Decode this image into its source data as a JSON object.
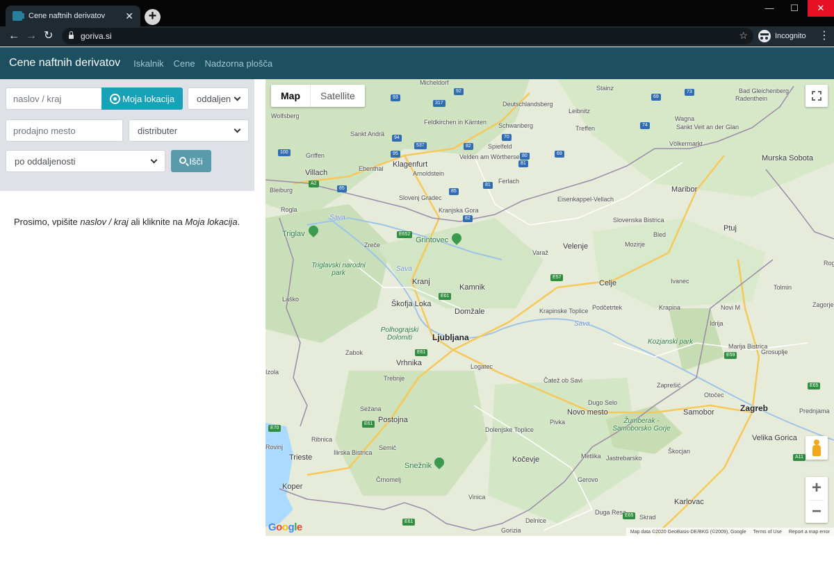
{
  "browser": {
    "tab_title": "Cene naftnih derivatov",
    "url": "goriva.si",
    "incognito_label": "Incognito"
  },
  "navbar": {
    "brand": "Cene naftnih derivatov",
    "links": [
      "Iskalnik",
      "Cene",
      "Nadzorna plošča"
    ]
  },
  "form": {
    "address_placeholder": "naslov / kraj",
    "location_button": "Moja lokacija",
    "distance_select": "oddaljen",
    "station_placeholder": "prodajno mesto",
    "distributor_select": "distributer",
    "sort_select": "po oddaljenosti",
    "search_button": "Išči"
  },
  "hint": {
    "prefix": "Prosimo, vpišite ",
    "em1": "naslov / kraj",
    "middle": " ali kliknite na ",
    "em2": "Moja lokacija",
    "suffix": "."
  },
  "map": {
    "type_map": "Map",
    "type_satellite": "Satellite",
    "google_logo": "Google",
    "attribution": "Map data ©2020 GeoBasis-DE/BKG (©2009), Google",
    "terms": "Terms of Use",
    "report": "Report a map error",
    "zoom_in": "+",
    "zoom_out": "−",
    "places": {
      "big": [
        "Ljubljana",
        "Zagreb"
      ],
      "mid": [
        "Villach",
        "Klagenfurt",
        "Maribor",
        "Celje",
        "Kranj",
        "Trieste",
        "Koper",
        "Murska Sobota",
        "Ptuj",
        "Novo mesto",
        "Velenje",
        "Kamnik",
        "Domžale",
        "Škofja Loka",
        "Vrhnika",
        "Postojna",
        "Kočevje",
        "Samobor",
        "Karlovac",
        "Velika Gorica"
      ],
      "small": [
        "Micheldorf",
        "Stainz",
        "Bad Gleichenberg",
        "Radenthein",
        "Wolfsberg",
        "Deutschlandsberg",
        "Leibnitz",
        "Wagna",
        "Sankt Veit an der Glan",
        "Feldkirchen in Kärnten",
        "Sankt Andrä",
        "Schwanberg",
        "Treffen",
        "Griffen",
        "Spielfeld",
        "Völkermarkt",
        "Velden am Wörthersee",
        "Ebenthal",
        "Arnoldstein",
        "Bleiburg",
        "Ferlach",
        "Slovenj Gradec",
        "Eisenkappel-Vellach",
        "Kranjska Gora",
        "Rogla",
        "Slovenska Bistrica",
        "Bled",
        "Zreče",
        "Mozirje",
        "Varaž",
        "Rogaška Slatina",
        "Ivanec",
        "Tolmin",
        "Laško",
        "Podčetrtek",
        "Krapina",
        "Novi M",
        "Zagorje ob Savi",
        "Krapinske Toplice",
        "Idrija",
        "Zabok",
        "Marija Bistrica",
        "Grosuplje",
        "Logatec",
        "Trebnje",
        "Čatež ob Savi",
        "Zaprešić",
        "Otočec",
        "Dugo Selo",
        "Prednjama",
        "Sežana",
        "Ribnica",
        "Dolenjske Toplice",
        "Pivka",
        "Semič",
        "Metlika",
        "Jastrebarsko",
        "Škocjan",
        "Ilirska Bistrica",
        "Črnomelj",
        "Gerovo",
        "Vinica",
        "Duga Resa",
        "Skrad",
        "Delnice",
        "Gorizia",
        "Izola",
        "Rovinj"
      ],
      "parks": [
        "Triglavski narodni park",
        "Polhograjski Dolomiti",
        "Kozjanski park",
        "Žumberak - Samoborsko Gorje"
      ],
      "peaks": [
        "Triglav",
        "Grintovec",
        "Snežnik"
      ],
      "rivers": [
        "Sava",
        "Sava",
        "Sava"
      ]
    }
  }
}
